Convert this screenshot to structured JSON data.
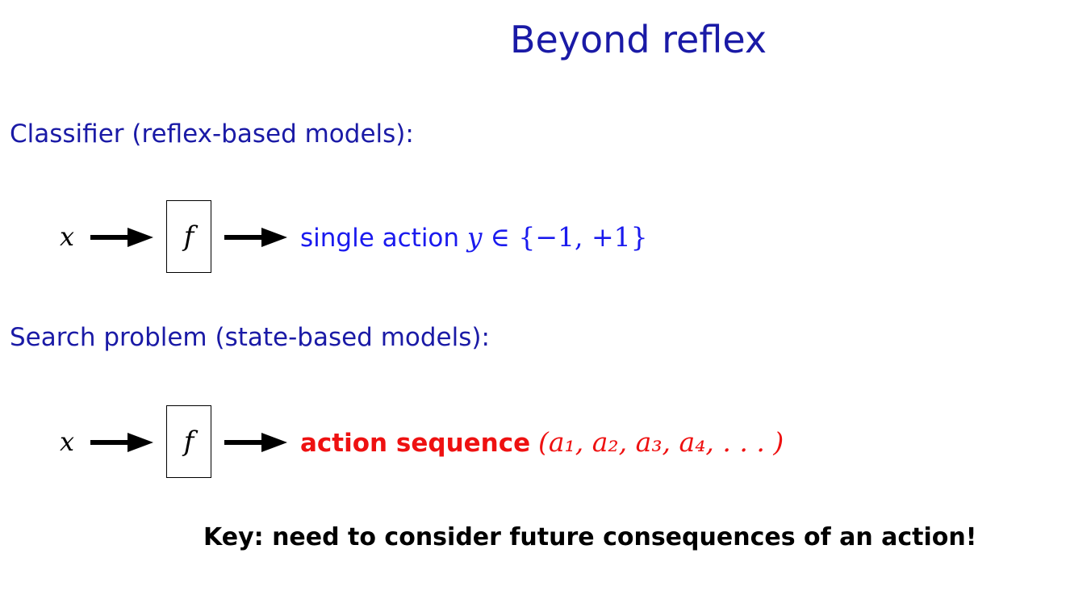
{
  "slide": {
    "title": "Beyond reflex",
    "classifier": {
      "heading": "Classifier (reflex-based models):",
      "input_var": "x",
      "function": "f",
      "output_label": "single action",
      "output_var": "y",
      "output_set": "∈ {−1, +1}"
    },
    "search": {
      "heading": "Search problem (state-based models):",
      "input_var": "x",
      "function": "f",
      "output_label": "action sequence",
      "output_math": "(a₁, a₂, a₃, a₄, . . . )"
    },
    "key_message": "Key: need to consider future consequences of an action!"
  },
  "colors": {
    "title": "#1a1aa6",
    "heading": "#1a1aa6",
    "classifier_output": "#1a1aee",
    "search_output": "#ee1111",
    "key_text": "#000000"
  },
  "icons": {
    "flow_arrow": "right-arrow-icon"
  }
}
